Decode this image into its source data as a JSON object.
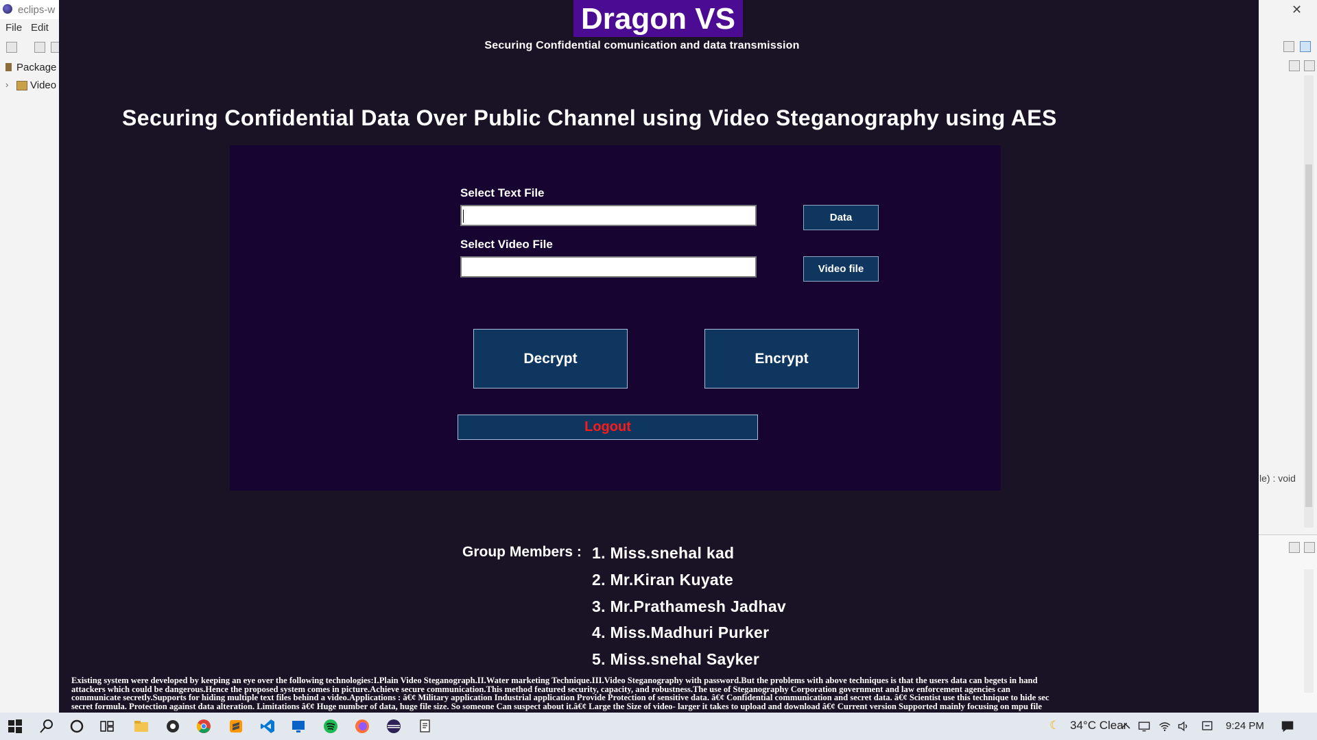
{
  "eclipse": {
    "title": "eclips-w",
    "menu": [
      "File",
      "Edit"
    ],
    "package_tab": "Package E",
    "tree_item": "Video",
    "outline_text": "le) : void",
    "close_glyph": "✕"
  },
  "app": {
    "brand": "Dragon VS",
    "tagline": "Securing Confidential comunication and data transmission",
    "heading": "Securing Confidential Data Over Public Channel using Video Steganography using AES",
    "form": {
      "text_file_label": "Select Text File",
      "text_file_value": "",
      "video_file_label": "Select Video File",
      "video_file_value": "",
      "data_button": "Data",
      "video_button": "Video file",
      "decrypt_button": "Decrypt",
      "encrypt_button": "Encrypt",
      "logout_button": "Logout"
    },
    "group_label": "Group Members :",
    "members": [
      "1. Miss.snehal kad",
      "2. Mr.Kiran Kuyate",
      "3. Mr.Prathamesh Jadhav",
      "4. Miss.Madhuri Purker",
      "5. Miss.snehal Sayker"
    ],
    "description_lines": [
      "Existing system were developed by keeping an eye over the following technologies:I.Plain Video Steganograph.II.Water marketing Technique.III.Video Steganography with password.But the problems with above techniques is that the users data can begets in hand",
      "attackers which could be dangerous.Hence the proposed system comes in picture.Achieve secure communication.This method featured security, capacity, and robustness.The use of Steganography Corporation government and law enforcement agencies can",
      "communicate secretly.Supports for hiding multiple text files behind a video.Applications : â€¢ Military application Industrial application Provide Protection of sensitive data. â€¢ Confidential communication and secret data. â€¢ Scientist use this technique to hide sec",
      "secret formula. Protection against data alteration. Limitations â€¢ Huge number of data, huge file size. So someone Can suspect about it.â€¢ Large the Size of video- larger it takes to upload and download â€¢ Current version Supported mainly focusing on mpu file"
    ]
  },
  "taskbar": {
    "weather": "34°C  Clear",
    "time": "9:24 PM",
    "accent": "#4a90d9"
  },
  "colors": {
    "app_background": "#1a1225",
    "panel_background": "#170430",
    "brand_background": "#4b0c93",
    "button_background": "#0f365e",
    "logout_text": "#ff1a1a"
  }
}
